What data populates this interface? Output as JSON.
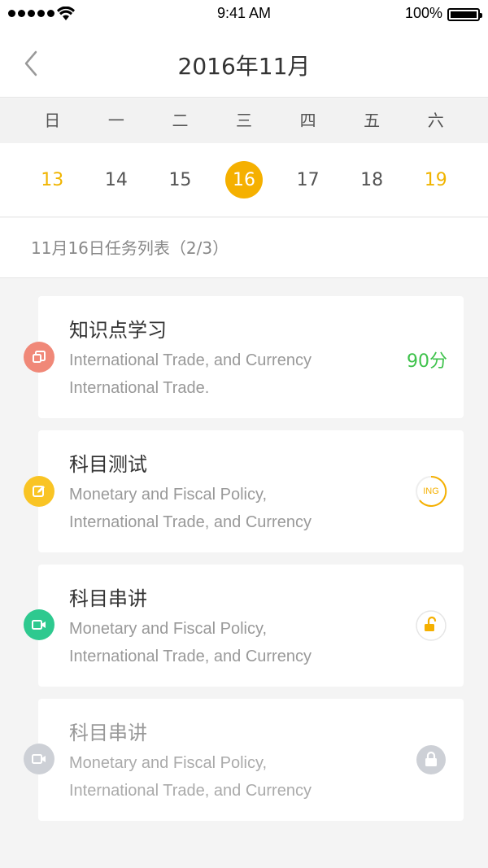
{
  "status": {
    "time": "9:41 AM",
    "battery": "100%"
  },
  "nav": {
    "title": "2016年11月"
  },
  "weekdays": [
    "日",
    "一",
    "二",
    "三",
    "四",
    "五",
    "六"
  ],
  "dates": [
    "13",
    "14",
    "15",
    "16",
    "17",
    "18",
    "19"
  ],
  "task_header": "11月16日任务列表（2/3）",
  "tasks": [
    {
      "title": "知识点学习",
      "desc_line1": "International Trade, and Currency",
      "desc_line2": "International Trade.",
      "score": "90分",
      "icon": "copy-icon",
      "color": "#f08878"
    },
    {
      "title": "科目测试",
      "desc_line1": "Monetary and Fiscal Policy,",
      "desc_line2": "International Trade, and Currency",
      "status_label": "ING",
      "icon": "edit-icon",
      "color": "#f9c424"
    },
    {
      "title": "科目串讲",
      "desc_line1": "Monetary and Fiscal Policy,",
      "desc_line2": "International Trade, and Currency",
      "icon": "video-icon",
      "color": "#2ec98f",
      "status_icon": "unlock-icon"
    },
    {
      "title": "科目串讲",
      "desc_line1": "Monetary and Fiscal Policy,",
      "desc_line2": "International Trade, and Currency",
      "icon": "video-icon",
      "color": "#cdd0d6",
      "status_icon": "lock-icon"
    }
  ],
  "colors": {
    "accent": "#f5b000",
    "weekend": "#f0b400",
    "score": "#3ec24b"
  }
}
